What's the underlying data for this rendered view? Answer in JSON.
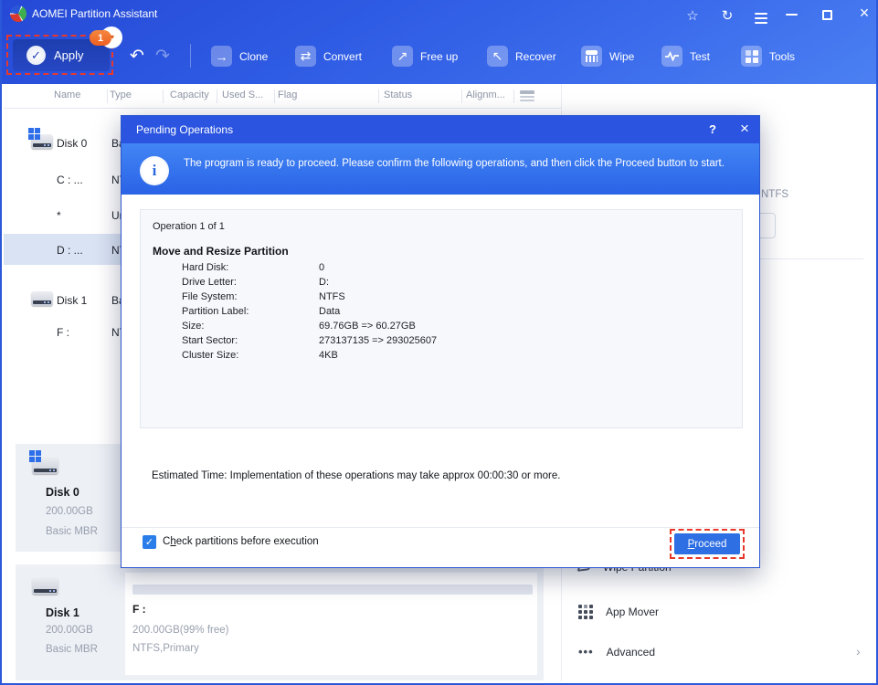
{
  "window": {
    "title": "AOMEI Partition Assistant",
    "controls": {
      "close": "×"
    }
  },
  "toolbar": {
    "apply": {
      "label": "Apply",
      "badge": "1",
      "badge_caret": "▾",
      "check": "✓"
    },
    "undo": "↶",
    "redo": "↷",
    "items": [
      {
        "label": "Clone",
        "glyph": "→"
      },
      {
        "label": "Convert",
        "glyph": "⇄"
      },
      {
        "label": "Free up",
        "glyph": "↗"
      },
      {
        "label": "Recover",
        "glyph": "↖"
      },
      {
        "label": "Wipe"
      },
      {
        "label": "Test"
      },
      {
        "label": "Tools"
      }
    ]
  },
  "table": {
    "columns": [
      "Name",
      "Type",
      "Capacity",
      "Used S...",
      "Flag",
      "Status",
      "Alignm..."
    ],
    "rows": [
      {
        "name": "Disk 0",
        "type": "Basic"
      },
      {
        "name": "C : ...",
        "type": "NTFS"
      },
      {
        "name": "*",
        "type": "Unallocated"
      },
      {
        "name": "D : ...",
        "type": "NTFS"
      },
      {
        "name": "Disk 1",
        "type": "Basic"
      },
      {
        "name": "F :",
        "type": "NTFS"
      }
    ]
  },
  "dialog": {
    "title": "Pending Operations",
    "help": "?",
    "close": "×",
    "info_glyph": "i",
    "banner": "The program is ready to proceed. Please confirm the following operations, and then click the Proceed button to start.",
    "operation": {
      "counter": "Operation 1 of 1",
      "name": "Move and Resize Partition",
      "fields": [
        {
          "label": "Hard Disk:",
          "value": "0"
        },
        {
          "label": "Drive Letter:",
          "value": "D:"
        },
        {
          "label": "File System:",
          "value": "NTFS"
        },
        {
          "label": "Partition Label:",
          "value": "Data"
        },
        {
          "label": "Size:",
          "value": "69.76GB => 60.27GB"
        },
        {
          "label": "Start Sector:",
          "value": "273137135 => 293025607"
        },
        {
          "label": "Cluster Size:",
          "value": "4KB"
        }
      ]
    },
    "estimated": "Estimated Time: Implementation of these operations may take approx 00:00:30 or more.",
    "checkbox": {
      "pre": "C",
      "mnemonic": "h",
      "post": "eck partitions before execution",
      "check": "✓"
    },
    "proceed": {
      "mnemonic": "P",
      "post": "roceed"
    }
  },
  "disks": [
    {
      "name": "Disk 0",
      "capacity": "200.00GB",
      "style": "Basic MBR"
    },
    {
      "name": "Disk 1",
      "capacity": "200.00GB",
      "style": "Basic MBR",
      "partition": {
        "letter": "F :",
        "size": "200.00GB(99% free)",
        "fs": "NTFS,Primary"
      }
    }
  ],
  "right_panel": {
    "fs_fragment": "NTFS",
    "menu": [
      {
        "label": "Wipe Partition"
      },
      {
        "label": "App Mover"
      },
      {
        "label": "Advanced",
        "chevron": "›"
      }
    ]
  },
  "colors": {
    "accent": "#2e6fe3",
    "annotation": "#e8382a",
    "selected_row": "#d9e3f3"
  }
}
